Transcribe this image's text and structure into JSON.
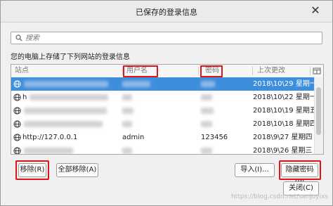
{
  "window": {
    "title": "已保存的登录信息",
    "close_glyph": "✕"
  },
  "search": {
    "placeholder": "搜索"
  },
  "description": "您的电脑上存储了下列网站的登录信息",
  "table": {
    "columns": {
      "site": "站点",
      "username": "用户名",
      "password": "密码",
      "last_changed": "上次更改"
    },
    "rows": [
      {
        "site": "",
        "username": "",
        "password": "",
        "last_changed": "2018\\10\\29 星期一",
        "selected": true
      },
      {
        "site": "h",
        "username": "",
        "password": "",
        "last_changed": "2018\\10\\22 星期一",
        "selected": false
      },
      {
        "site": "",
        "username": "",
        "password": "",
        "last_changed": "2018\\10\\19 星期五",
        "selected": false
      },
      {
        "site": "",
        "username": "",
        "password": "",
        "last_changed": "2018\\10\\18 星期四",
        "selected": false
      },
      {
        "site": "http://127.0.0.1",
        "username": "admin",
        "password": "123456",
        "last_changed": "2018\\9\\27 星期四",
        "selected": false
      },
      {
        "site": "",
        "username": "",
        "password": "",
        "last_changed": "2018\\9\\26 星期三",
        "selected": false
      }
    ]
  },
  "buttons": {
    "remove": "移除(R)",
    "remove_all": "全部移除(A)",
    "import": "导入(I)...",
    "hide_passwords": "隐藏密码(P)",
    "close": "关闭(C)"
  },
  "watermark": "https://blog.csdn.net/sanjoyixs",
  "colors": {
    "selection": "#3e8ede",
    "annotation_red": "#e0151b"
  },
  "icons": {
    "search": "search-icon",
    "site": "globe-icon",
    "column_picker": "column-picker-icon",
    "close": "close-icon"
  }
}
